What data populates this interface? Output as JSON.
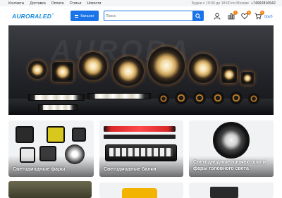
{
  "topbar": {
    "links": [
      "Контакты",
      "Доставка",
      "Оплата",
      "Статьи",
      "Новости"
    ],
    "hours": "Будни с 10:00 до 18:00 по Москве",
    "phone": "+74992816542"
  },
  "header": {
    "logo_text": "AURORALED",
    "logo_tm": "®",
    "catalog_label": "Каталог",
    "search_placeholder": "Поиск",
    "compare_count": "1",
    "favorites_count": "0",
    "cart_count": "0",
    "cart_total": "0руб"
  },
  "categories": [
    {
      "label": "Светодиодные фары"
    },
    {
      "label": "Светодиодные балки"
    },
    {
      "label": "Светодиодные прожекторы и фары головного света"
    }
  ],
  "colors": {
    "accent": "#1a73e8",
    "badge": "#f57c00",
    "logo": "#1a8cdc"
  },
  "icons": {
    "search": "search-icon",
    "user": "user-icon",
    "compare": "compare-icon",
    "favorites": "heart-icon",
    "cart": "cart-icon",
    "catalog": "menu-icon"
  }
}
